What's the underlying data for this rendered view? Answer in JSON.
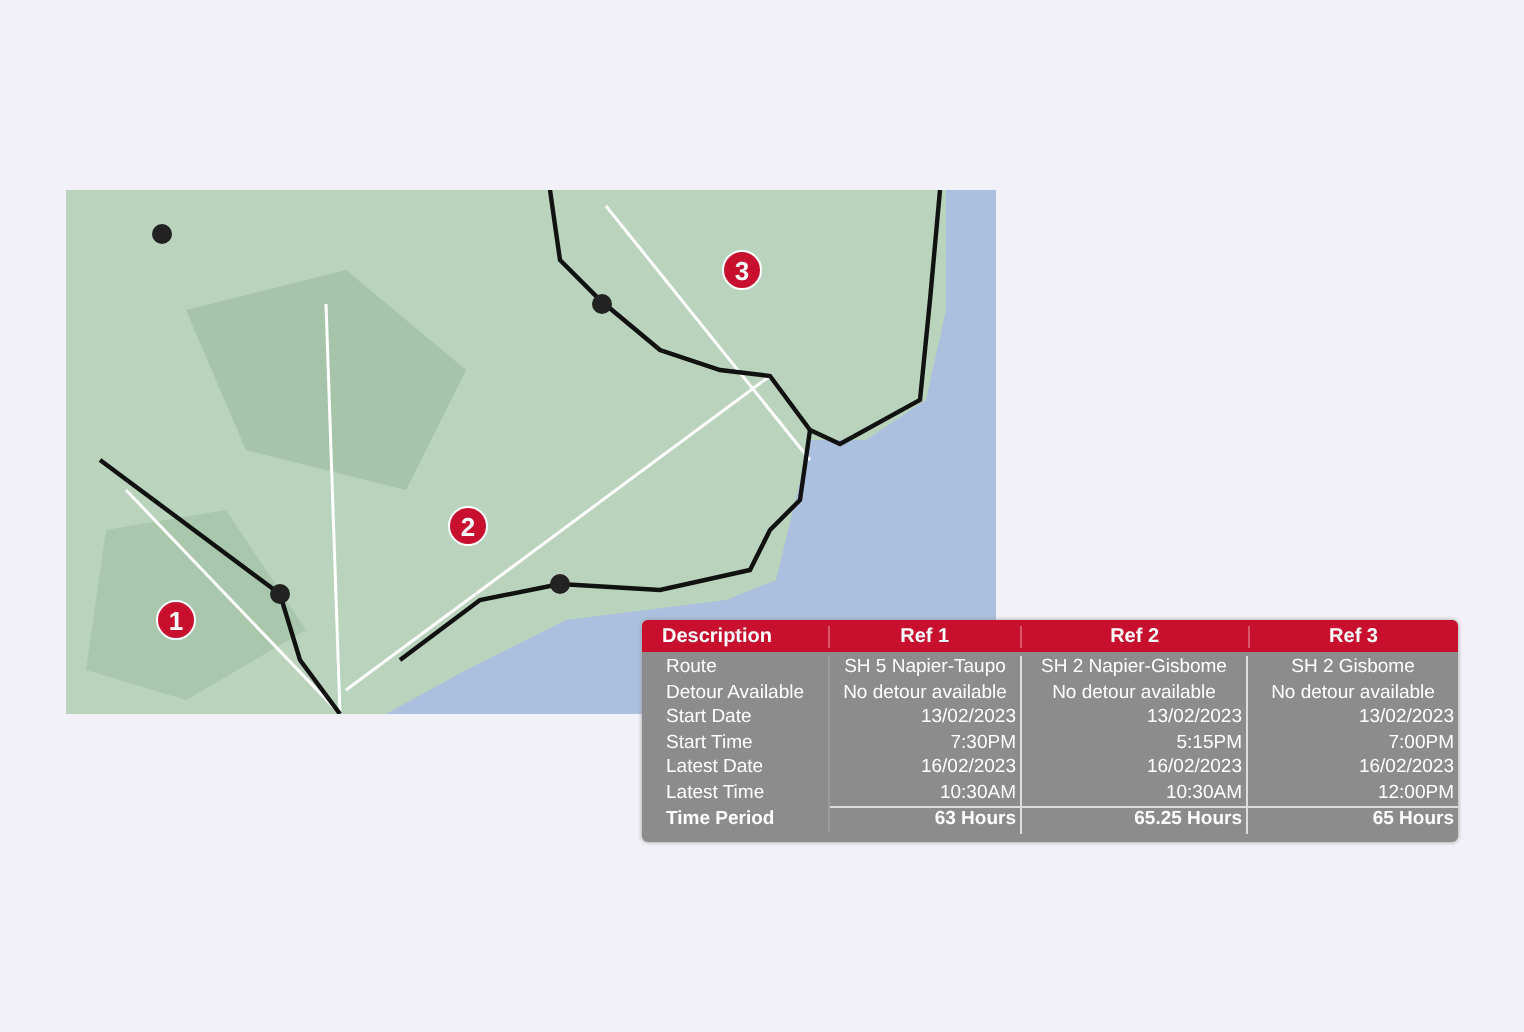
{
  "map": {
    "markers": [
      {
        "label": "1"
      },
      {
        "label": "2"
      },
      {
        "label": "3"
      }
    ]
  },
  "table": {
    "columns": [
      "Description",
      "Ref 1",
      "Ref 2",
      "Ref 3"
    ],
    "rows": [
      {
        "kind": "text",
        "cells": [
          "Route",
          "SH 5 Napier-Taupo",
          "SH 2 Napier-Gisbome",
          "SH 2 Gisbome"
        ]
      },
      {
        "kind": "text",
        "cells": [
          "Detour Available",
          "No detour available",
          "No detour available",
          "No detour available"
        ]
      },
      {
        "kind": "value",
        "cells": [
          "Start Date",
          "13/02/2023",
          "13/02/2023",
          "13/02/2023"
        ]
      },
      {
        "kind": "value",
        "cells": [
          "Start Time",
          "7:30PM",
          "5:15PM",
          "7:00PM"
        ]
      },
      {
        "kind": "value",
        "cells": [
          "Latest Date",
          "16/02/2023",
          "16/02/2023",
          "16/02/2023"
        ]
      },
      {
        "kind": "value",
        "cells": [
          "Latest Time",
          "10:30AM",
          "10:30AM",
          "12:00PM"
        ]
      },
      {
        "kind": "total",
        "cells": [
          "Time Period",
          "63 Hours",
          "65.25 Hours",
          "65 Hours"
        ]
      }
    ]
  }
}
